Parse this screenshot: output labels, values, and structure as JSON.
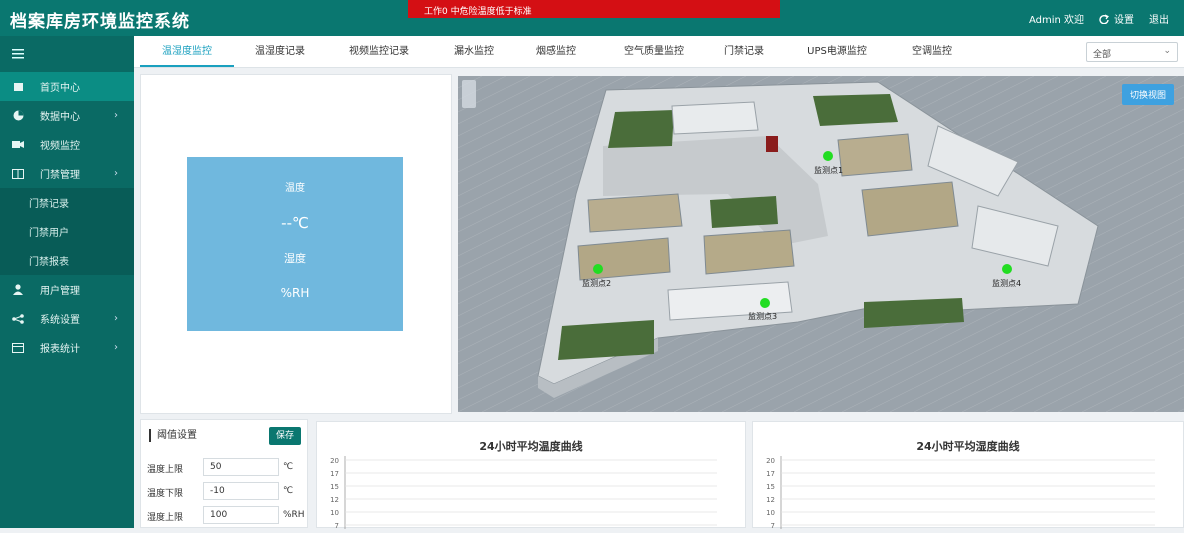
{
  "header": {
    "title": "档案库房环境监控系统",
    "alert": "工作0 中危险温度低于标准",
    "user": "Admin 欢迎",
    "logout_label": "退出",
    "settings_label": "设置"
  },
  "sidebar": {
    "items": [
      {
        "label": "首页中心",
        "icon": "home-icon",
        "active": true,
        "has_children": false
      },
      {
        "label": "数据中心",
        "icon": "chart-icon",
        "has_children": true
      },
      {
        "label": "视频监控",
        "icon": "camera-icon",
        "has_children": false
      },
      {
        "label": "门禁管理",
        "icon": "door-icon",
        "has_children": true,
        "expanded": true
      }
    ],
    "sub_items": [
      "门禁记录",
      "门禁用户",
      "门禁报表"
    ],
    "items_after": [
      {
        "label": "用户管理",
        "icon": "user-icon",
        "has_children": false
      },
      {
        "label": "系统设置",
        "icon": "share-icon",
        "has_children": true
      },
      {
        "label": "报表统计",
        "icon": "report-icon",
        "has_children": true
      }
    ]
  },
  "tabs": [
    "温湿度监控",
    "温湿度记录",
    "视频监控记录",
    "漏水监控",
    "烟感监控",
    "空气质量监控",
    "门禁记录",
    "UPS电源监控",
    "空调监控"
  ],
  "tab_select_value": "全部",
  "info_card": {
    "label": "温度",
    "temperature": "--℃",
    "label2": "湿度",
    "humidity": "%RH"
  },
  "view3d": {
    "button_label": "切换视图",
    "sensors": [
      "监测点1",
      "监测点2",
      "监测点3",
      "监测点4"
    ]
  },
  "thresholds": {
    "title": "阈值设置",
    "save_label": "保存",
    "rows": [
      {
        "label": "温度上限",
        "value": "50",
        "unit": "℃"
      },
      {
        "label": "温度下限",
        "value": "-10",
        "unit": "℃"
      },
      {
        "label": "湿度上限",
        "value": "100",
        "unit": "%RH"
      }
    ]
  },
  "colors": {
    "topbar": "#0a7770",
    "sidebar": "#0a6a64",
    "accent": "#1aa0bf",
    "alert": "#d40f14",
    "info_card": "#70b8de"
  },
  "chart_data": [
    {
      "type": "line",
      "title": "24小时平均温度曲线",
      "yticks": [
        "20",
        "17",
        "15",
        "12",
        "10",
        "7"
      ],
      "series": []
    },
    {
      "type": "line",
      "title": "24小时平均湿度曲线",
      "yticks": [
        "20",
        "17",
        "15",
        "12",
        "10",
        "7"
      ],
      "series": []
    }
  ]
}
